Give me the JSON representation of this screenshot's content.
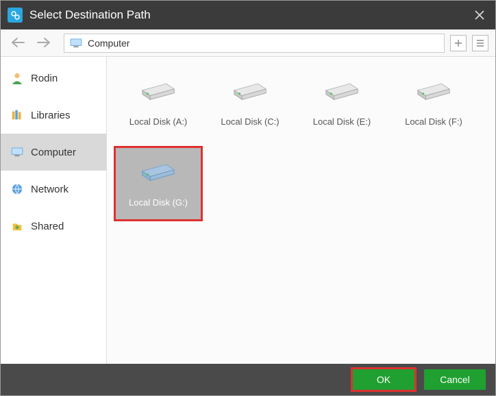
{
  "window": {
    "title": "Select Destination Path"
  },
  "location": {
    "path": "Computer"
  },
  "sidebar": {
    "items": [
      {
        "label": "Rodin"
      },
      {
        "label": "Libraries"
      },
      {
        "label": "Computer"
      },
      {
        "label": "Network"
      },
      {
        "label": "Shared"
      }
    ]
  },
  "drives": [
    {
      "label": "Local Disk (A:)",
      "selected": false
    },
    {
      "label": "Local Disk (C:)",
      "selected": false
    },
    {
      "label": "Local Disk (E:)",
      "selected": false
    },
    {
      "label": "Local Disk (F:)",
      "selected": false
    },
    {
      "label": "Local Disk (G:)",
      "selected": true
    }
  ],
  "footer": {
    "ok": "OK",
    "cancel": "Cancel"
  }
}
